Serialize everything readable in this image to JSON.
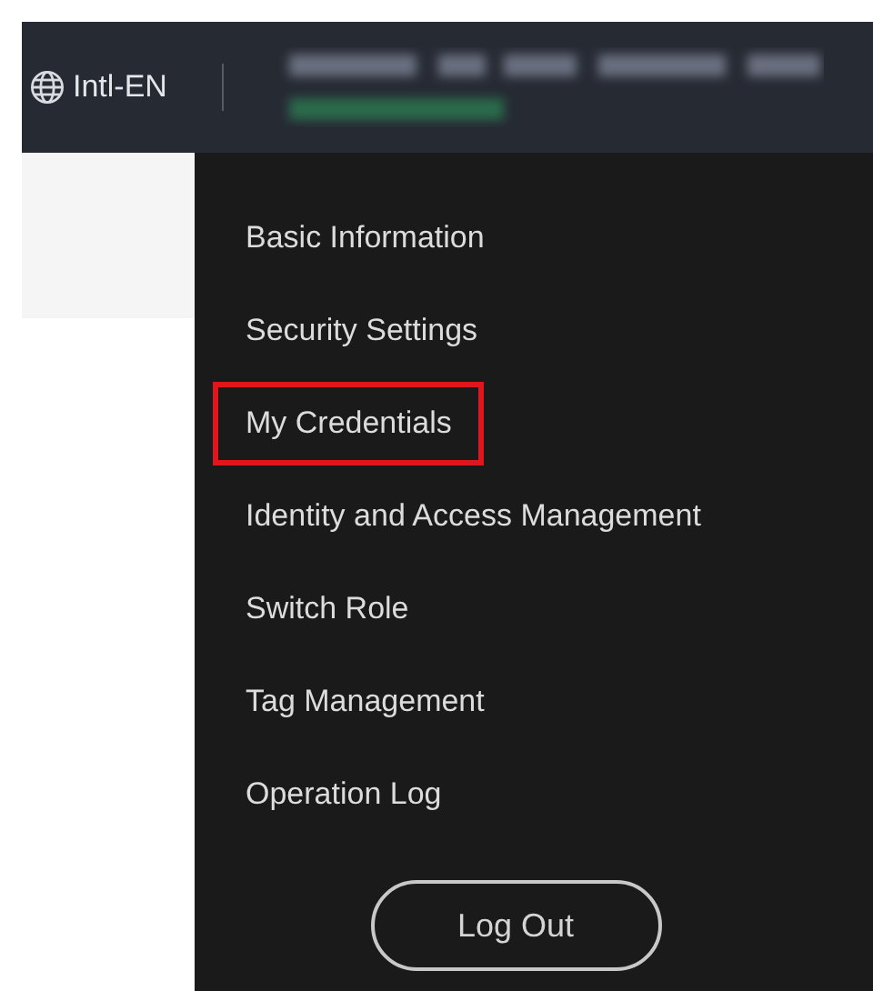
{
  "top_bar": {
    "language": "Intl-EN"
  },
  "menu": {
    "items": [
      {
        "label": "Basic Information",
        "highlighted": false
      },
      {
        "label": "Security Settings",
        "highlighted": false
      },
      {
        "label": "My Credentials",
        "highlighted": true
      },
      {
        "label": "Identity and Access Management",
        "highlighted": false
      },
      {
        "label": "Switch Role",
        "highlighted": false
      },
      {
        "label": "Tag Management",
        "highlighted": false
      },
      {
        "label": "Operation Log",
        "highlighted": false
      }
    ],
    "logout_button": "Log Out"
  }
}
